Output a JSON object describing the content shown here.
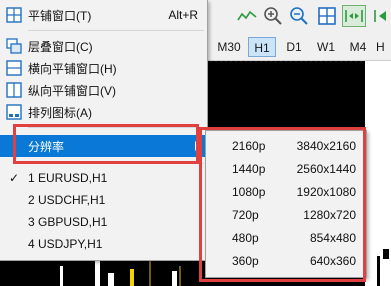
{
  "toolbar": {
    "icons": [
      "tile-window-icon",
      "line-chart-icon",
      "zoom-in-icon",
      "zoom-out-icon",
      "grid-icon",
      "autoscroll-icon",
      "shift-chart-icon"
    ]
  },
  "timeframes": {
    "items": [
      "M30",
      "H1",
      "D1",
      "W1",
      "M4",
      "H"
    ],
    "active": "H1"
  },
  "menu": {
    "items": [
      {
        "label": "平铺窗口(T)",
        "shortcut": "Alt+R",
        "icon": "tile-icon"
      },
      {
        "label": "层叠窗口(C)",
        "shortcut": "",
        "icon": "cascade-icon"
      },
      {
        "label": "横向平铺窗口(H)",
        "shortcut": "",
        "icon": "tile-horizontal-icon"
      },
      {
        "label": "纵向平铺窗口(V)",
        "shortcut": "",
        "icon": "tile-vertical-icon"
      },
      {
        "label": "排列图标(A)",
        "shortcut": "",
        "icon": "arrange-icons-icon"
      },
      {
        "label": "分辨率",
        "shortcut": "",
        "icon": ""
      },
      {
        "label": "1 EURUSD,H1",
        "shortcut": "",
        "icon": ""
      },
      {
        "label": "2 USDCHF,H1",
        "shortcut": "",
        "icon": ""
      },
      {
        "label": "3 GBPUSD,H1",
        "shortcut": "",
        "icon": ""
      },
      {
        "label": "4 USDJPY,H1",
        "shortcut": "",
        "icon": ""
      }
    ],
    "checked_mark": "✓"
  },
  "submenu": {
    "items": [
      {
        "res": "2160p",
        "dims": "3840x2160"
      },
      {
        "res": "1440p",
        "dims": "2560x1440"
      },
      {
        "res": "1080p",
        "dims": "1920x1080"
      },
      {
        "res": "720p",
        "dims": "1280x720"
      },
      {
        "res": "480p",
        "dims": "854x480"
      },
      {
        "res": "360p",
        "dims": "640x360"
      }
    ]
  },
  "colors": {
    "highlight": "#0a78d7",
    "annotation": "#e04040"
  }
}
